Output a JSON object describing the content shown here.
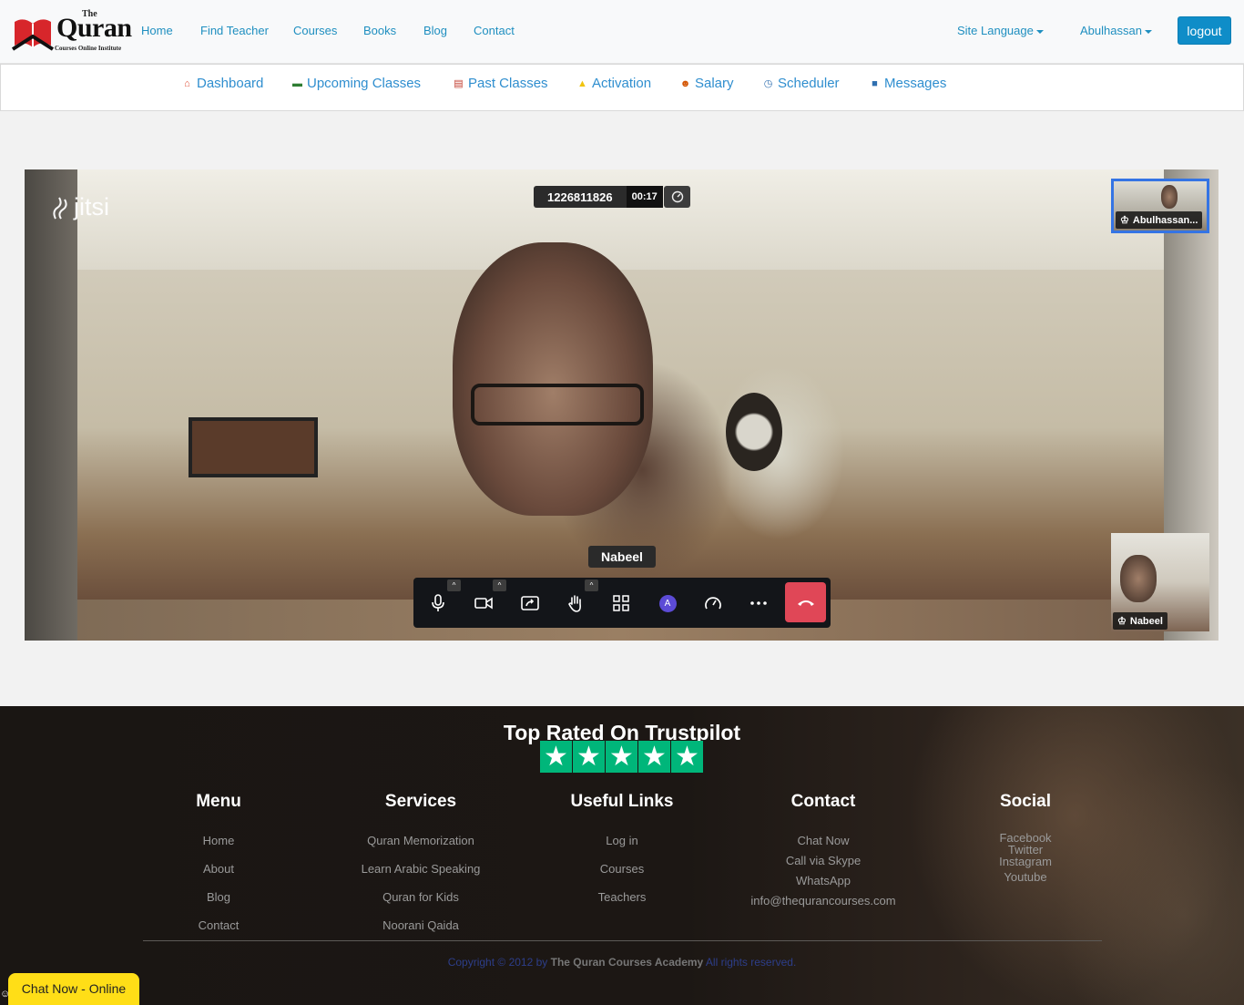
{
  "brand": {
    "the": "The",
    "name": "Quran",
    "subtitle": "Courses Online Institute"
  },
  "topnav": {
    "links": [
      "Home",
      "Find Teacher",
      "Courses",
      "Books",
      "Blog",
      "Contact"
    ],
    "site_language": "Site Language",
    "user": "Abulhassan",
    "logout": "logout"
  },
  "subnav": {
    "items": [
      {
        "label": "Dashboard",
        "icon": "home-icon"
      },
      {
        "label": "Upcoming Classes",
        "icon": "calendar-icon"
      },
      {
        "label": "Past Classes",
        "icon": "history-icon"
      },
      {
        "label": "Activation",
        "icon": "bell-icon"
      },
      {
        "label": "Salary",
        "icon": "users-icon"
      },
      {
        "label": "Scheduler",
        "icon": "clock-icon"
      },
      {
        "label": "Messages",
        "icon": "chat-icon"
      }
    ]
  },
  "meeting": {
    "brand": "jitsi",
    "room_id": "1226811826",
    "elapsed": "00:17",
    "main_speaker": "Nabeel",
    "thumbnails": [
      {
        "name": "Abulhassan..."
      },
      {
        "name": "Nabeel"
      }
    ],
    "avatar_initial": "A"
  },
  "footer": {
    "trustpilot": "Top Rated On Trustpilot",
    "columns": {
      "menu": {
        "title": "Menu",
        "links": [
          "Home",
          "About",
          "Blog",
          "Contact"
        ]
      },
      "services": {
        "title": "Services",
        "links": [
          "Quran Memorization",
          "Learn Arabic Speaking",
          "Quran for Kids",
          "Noorani Qaida"
        ]
      },
      "useful": {
        "title": "Useful Links",
        "links": [
          "Log in",
          "Courses",
          "Teachers"
        ]
      },
      "contact": {
        "title": "Contact",
        "links": [
          "Chat Now",
          "Call via Skype",
          "WhatsApp",
          "info@thequrancourses.com"
        ]
      },
      "social": {
        "title": "Social",
        "links": [
          "Facebook",
          "Twitter",
          "Instagram",
          "Youtube"
        ]
      }
    },
    "copyright_prefix": "Copyright © 2012 by",
    "copyright_brand": "The Quran Courses Academy",
    "copyright_suffix": "All rights reserved."
  },
  "chat_widget": {
    "label": "Chat Now - Online"
  },
  "colors": {
    "link": "#1f8fc0",
    "logout": "#0f8dc8",
    "hangup": "#e04757",
    "trustpilot": "#00b67a",
    "chat": "#ffde17"
  }
}
